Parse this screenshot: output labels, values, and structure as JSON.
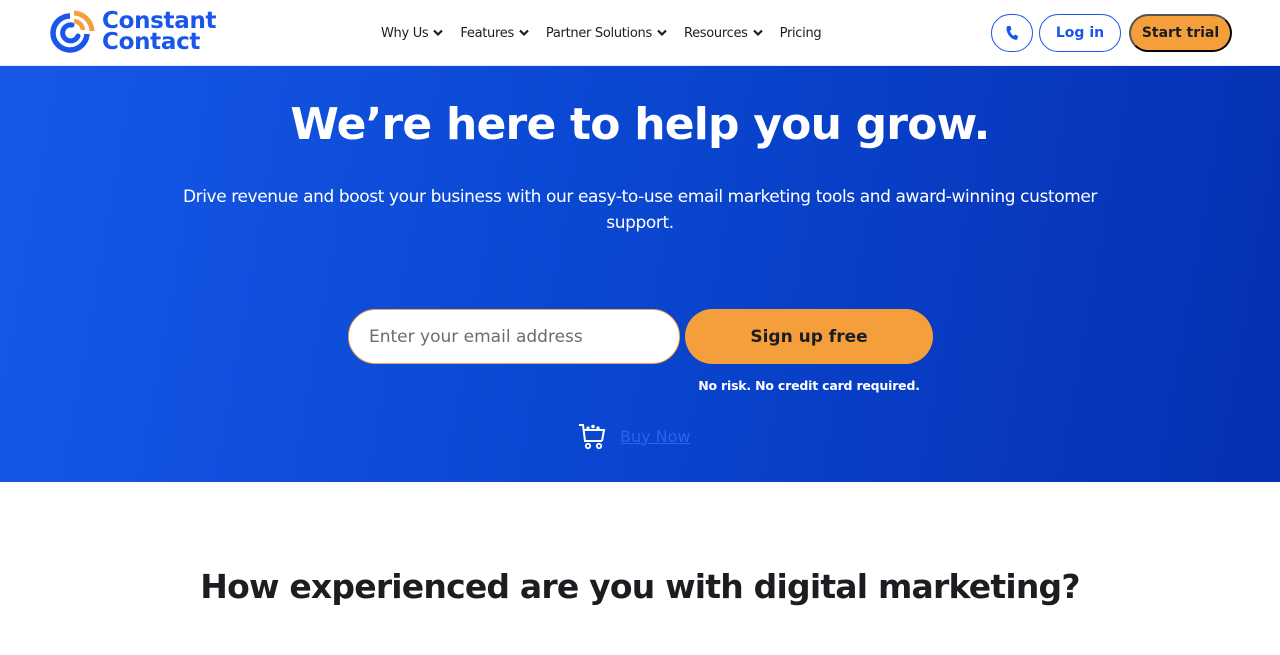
{
  "brand": {
    "name_line1": "Constant",
    "name_line2": "Contact",
    "colors": {
      "primary": "#1856ed",
      "accent": "#f59e3c"
    }
  },
  "nav": {
    "items": [
      {
        "label": "Why Us",
        "has_dropdown": true
      },
      {
        "label": "Features",
        "has_dropdown": true
      },
      {
        "label": "Partner Solutions",
        "has_dropdown": true
      },
      {
        "label": "Resources",
        "has_dropdown": true
      },
      {
        "label": "Pricing",
        "has_dropdown": false
      }
    ]
  },
  "header_actions": {
    "phone_icon": "phone-icon",
    "login_label": "Log in",
    "start_trial_label": "Start trial"
  },
  "hero": {
    "title": "We’re here to help you grow.",
    "subtitle": "Drive revenue and boost your business with our easy-to-use email marketing tools and award-winning customer support.",
    "email_placeholder": "Enter your email address",
    "email_value": "",
    "signup_label": "Sign up free",
    "no_risk_text": "No risk. No credit card required.",
    "buy_now_icon": "shopping-cart-icon",
    "buy_now_label": "Buy Now"
  },
  "section": {
    "question_title": "How experienced are you with digital marketing?"
  }
}
